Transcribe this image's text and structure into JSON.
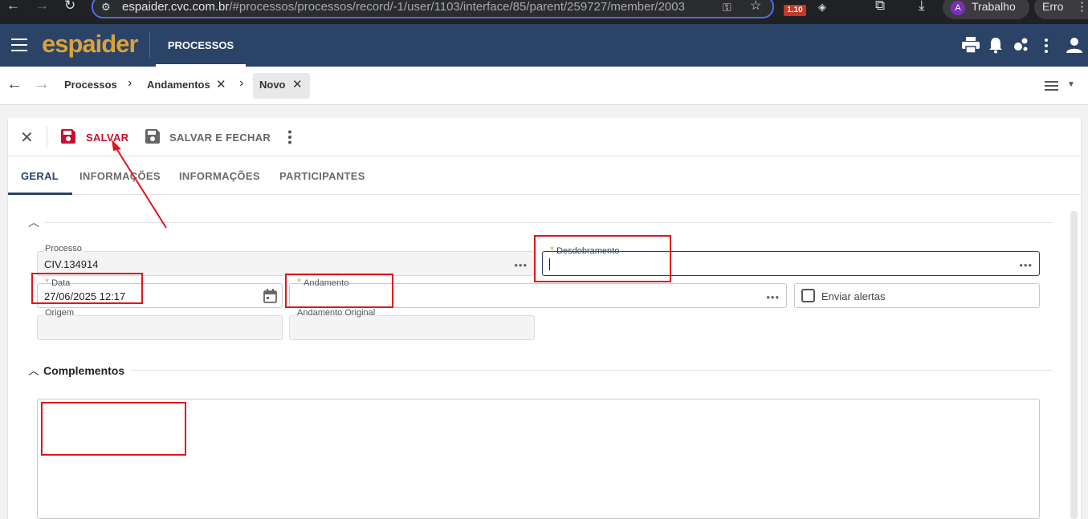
{
  "browser": {
    "url_host": "espaider.cvc.com.br",
    "url_path": "/#processos/processos/record/-1/user/1103/interface/85/parent/259727/member/2003",
    "extension_badge": "1.10",
    "profile_initial": "A",
    "profile_name": "Trabalho",
    "error_label": "Erro"
  },
  "header": {
    "logo": "espaider",
    "module_tab": "PROCESSOS"
  },
  "breadcrumb": {
    "items": [
      {
        "label": "Processos"
      },
      {
        "label": "Andamentos"
      },
      {
        "label": "Novo"
      }
    ]
  },
  "toolbar": {
    "save_label": "SALVAR",
    "save_close_label": "SALVAR E FECHAR"
  },
  "tabs": [
    {
      "label": "GERAL",
      "active": true
    },
    {
      "label": "INFORMAÇÕES"
    },
    {
      "label": "INFORMAÇÕES"
    },
    {
      "label": "PARTICIPANTES"
    }
  ],
  "form": {
    "processo": {
      "label": "Processo",
      "value": "CIV.134914"
    },
    "desdobramento": {
      "label": "Desdobramento",
      "value": "",
      "required": true
    },
    "data": {
      "label": "Data",
      "value": "27/06/2025 12:17",
      "required": true
    },
    "andamento": {
      "label": "Andamento",
      "value": "",
      "required": true
    },
    "enviar_alertas": {
      "label": "Enviar alertas",
      "checked": false
    },
    "origem": {
      "label": "Origem",
      "value": ""
    },
    "andamento_original": {
      "label": "Andamento Original",
      "value": ""
    }
  },
  "complementos": {
    "title": "Complementos",
    "value": ""
  },
  "colors": {
    "header_bg": "#2b4366",
    "accent_red": "#c8102e",
    "logo_gold": "#d9a23c",
    "annotation_red": "#e0141e"
  }
}
